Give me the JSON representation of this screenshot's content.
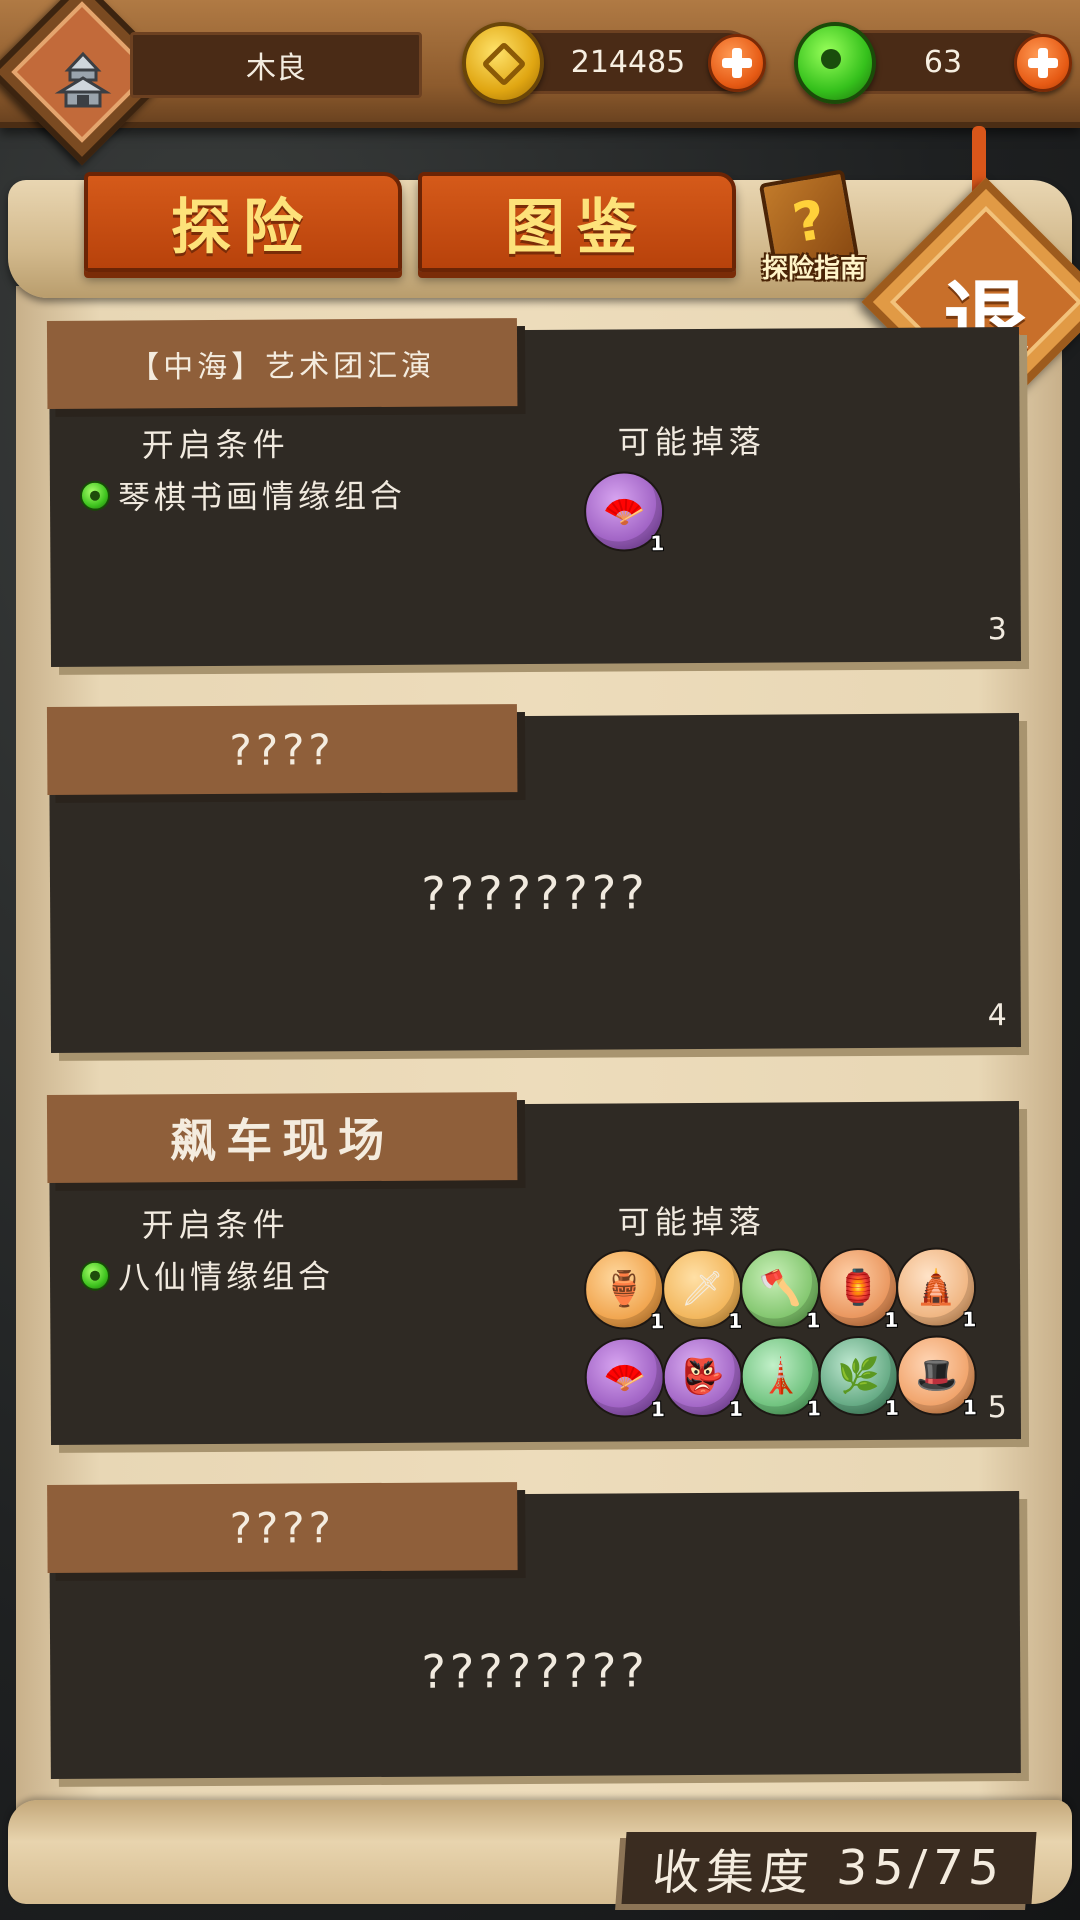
{
  "header": {
    "player_name": "木良",
    "gold": "214485",
    "jade": "63",
    "colors": {
      "bar": "#8d5b2d",
      "gold": "#e0a612",
      "jade": "#35c11c",
      "plus": "#e65a14"
    }
  },
  "tabs": [
    {
      "label": "探险"
    },
    {
      "label": "图鉴"
    }
  ],
  "guide_label": "探险指南",
  "exit_label": "退",
  "labels": {
    "condition": "开启条件",
    "drops": "可能掉落"
  },
  "stages": [
    {
      "title": "【中海】艺术团汇演",
      "condition": "琴棋书画情缘组合",
      "number": "3",
      "drops": [
        {
          "icon": "purple-fan-icon",
          "qty": "1",
          "color": "#9d5fc2"
        }
      ]
    },
    {
      "title": "????",
      "hidden": "????????",
      "number": "4"
    },
    {
      "title": "飙车现场",
      "condition": "八仙情缘组合",
      "number": "5",
      "drops": [
        {
          "icon": "gourd-icon",
          "qty": "1",
          "color": "#f0a24a"
        },
        {
          "icon": "sword-icon",
          "qty": "1",
          "color": "#f2b458"
        },
        {
          "icon": "axe-icon",
          "qty": "1",
          "color": "#7fc46b"
        },
        {
          "icon": "lantern-icon",
          "qty": "1",
          "color": "#e8935a"
        },
        {
          "icon": "pagoda-icon",
          "qty": "1",
          "color": "#efb37e"
        },
        {
          "icon": "purple-fan-icon",
          "qty": "1",
          "color": "#9d5fc2"
        },
        {
          "icon": "purple-mask-icon",
          "qty": "1",
          "color": "#a063c4"
        },
        {
          "icon": "green-tower-icon",
          "qty": "1",
          "color": "#6bc07a"
        },
        {
          "icon": "green-wreath-icon",
          "qty": "1",
          "color": "#5fa67f"
        },
        {
          "icon": "red-hat-icon",
          "qty": "1",
          "color": "#f0a167"
        }
      ]
    },
    {
      "title": "????",
      "hidden": "????????"
    }
  ],
  "collection": {
    "label": "收集度",
    "value": "35/75"
  }
}
